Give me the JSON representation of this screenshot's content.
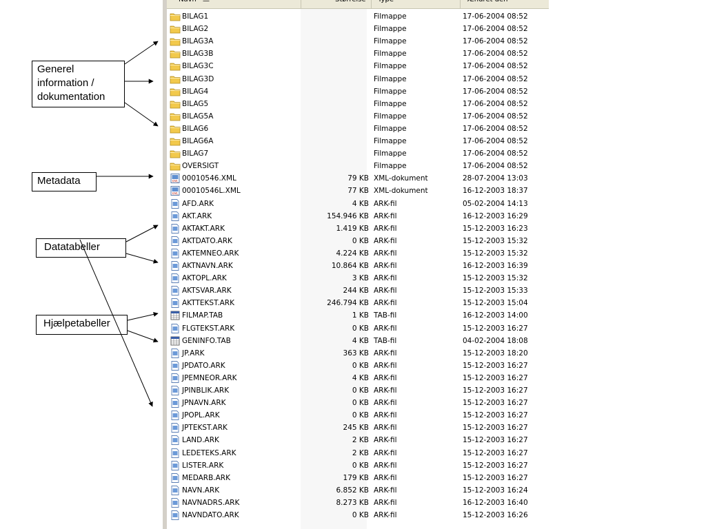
{
  "header": {
    "name": "Navn",
    "size": "Størrelse",
    "type": "Type",
    "modified": "Ændret den"
  },
  "rows": [
    {
      "name": "BILAG1",
      "size": "",
      "type": "Filmappe",
      "date": "17-06-2004 08:52",
      "icon": "folder"
    },
    {
      "name": "BILAG2",
      "size": "",
      "type": "Filmappe",
      "date": "17-06-2004 08:52",
      "icon": "folder"
    },
    {
      "name": "BILAG3A",
      "size": "",
      "type": "Filmappe",
      "date": "17-06-2004 08:52",
      "icon": "folder"
    },
    {
      "name": "BILAG3B",
      "size": "",
      "type": "Filmappe",
      "date": "17-06-2004 08:52",
      "icon": "folder"
    },
    {
      "name": "BILAG3C",
      "size": "",
      "type": "Filmappe",
      "date": "17-06-2004 08:52",
      "icon": "folder"
    },
    {
      "name": "BILAG3D",
      "size": "",
      "type": "Filmappe",
      "date": "17-06-2004 08:52",
      "icon": "folder"
    },
    {
      "name": "BILAG4",
      "size": "",
      "type": "Filmappe",
      "date": "17-06-2004 08:52",
      "icon": "folder"
    },
    {
      "name": "BILAG5",
      "size": "",
      "type": "Filmappe",
      "date": "17-06-2004 08:52",
      "icon": "folder"
    },
    {
      "name": "BILAG5A",
      "size": "",
      "type": "Filmappe",
      "date": "17-06-2004 08:52",
      "icon": "folder"
    },
    {
      "name": "BILAG6",
      "size": "",
      "type": "Filmappe",
      "date": "17-06-2004 08:52",
      "icon": "folder"
    },
    {
      "name": "BILAG6A",
      "size": "",
      "type": "Filmappe",
      "date": "17-06-2004 08:52",
      "icon": "folder"
    },
    {
      "name": "BILAG7",
      "size": "",
      "type": "Filmappe",
      "date": "17-06-2004 08:52",
      "icon": "folder"
    },
    {
      "name": "OVERSIGT",
      "size": "",
      "type": "Filmappe",
      "date": "17-06-2004 08:52",
      "icon": "folder"
    },
    {
      "name": "00010546.XML",
      "size": "79 KB",
      "type": "XML-dokument",
      "date": "28-07-2004 13:03",
      "icon": "xml"
    },
    {
      "name": "00010546L.XML",
      "size": "77 KB",
      "type": "XML-dokument",
      "date": "16-12-2003 18:37",
      "icon": "xml"
    },
    {
      "name": "AFD.ARK",
      "size": "4 KB",
      "type": "ARK-fil",
      "date": "05-02-2004 14:13",
      "icon": "file"
    },
    {
      "name": "AKT.ARK",
      "size": "154.946 KB",
      "type": "ARK-fil",
      "date": "16-12-2003 16:29",
      "icon": "file"
    },
    {
      "name": "AKTAKT.ARK",
      "size": "1.419 KB",
      "type": "ARK-fil",
      "date": "15-12-2003 16:23",
      "icon": "file"
    },
    {
      "name": "AKTDATO.ARK",
      "size": "0 KB",
      "type": "ARK-fil",
      "date": "15-12-2003 15:32",
      "icon": "file"
    },
    {
      "name": "AKTEMNEO.ARK",
      "size": "4.224 KB",
      "type": "ARK-fil",
      "date": "15-12-2003 15:32",
      "icon": "file"
    },
    {
      "name": "AKTNAVN.ARK",
      "size": "10.864 KB",
      "type": "ARK-fil",
      "date": "16-12-2003 16:39",
      "icon": "file"
    },
    {
      "name": "AKTOPL.ARK",
      "size": "3 KB",
      "type": "ARK-fil",
      "date": "15-12-2003 15:32",
      "icon": "file"
    },
    {
      "name": "AKTSVAR.ARK",
      "size": "244 KB",
      "type": "ARK-fil",
      "date": "15-12-2003 15:33",
      "icon": "file"
    },
    {
      "name": "AKTTEKST.ARK",
      "size": "246.794 KB",
      "type": "ARK-fil",
      "date": "15-12-2003 15:04",
      "icon": "file"
    },
    {
      "name": "FILMAP.TAB",
      "size": "1 KB",
      "type": "TAB-fil",
      "date": "16-12-2003 14:00",
      "icon": "tab"
    },
    {
      "name": "FLGTEKST.ARK",
      "size": "0 KB",
      "type": "ARK-fil",
      "date": "15-12-2003 16:27",
      "icon": "file"
    },
    {
      "name": "GENINFO.TAB",
      "size": "4 KB",
      "type": "TAB-fil",
      "date": "04-02-2004 18:08",
      "icon": "tab"
    },
    {
      "name": "JP.ARK",
      "size": "363 KB",
      "type": "ARK-fil",
      "date": "15-12-2003 18:20",
      "icon": "file"
    },
    {
      "name": "JPDATO.ARK",
      "size": "0 KB",
      "type": "ARK-fil",
      "date": "15-12-2003 16:27",
      "icon": "file"
    },
    {
      "name": "JPEMNEOR.ARK",
      "size": "4 KB",
      "type": "ARK-fil",
      "date": "15-12-2003 16:27",
      "icon": "file"
    },
    {
      "name": "JPINBLIK.ARK",
      "size": "0 KB",
      "type": "ARK-fil",
      "date": "15-12-2003 16:27",
      "icon": "file"
    },
    {
      "name": "JPNAVN.ARK",
      "size": "0 KB",
      "type": "ARK-fil",
      "date": "15-12-2003 16:27",
      "icon": "file"
    },
    {
      "name": "JPOPL.ARK",
      "size": "0 KB",
      "type": "ARK-fil",
      "date": "15-12-2003 16:27",
      "icon": "file"
    },
    {
      "name": "JPTEKST.ARK",
      "size": "245 KB",
      "type": "ARK-fil",
      "date": "15-12-2003 16:27",
      "icon": "file"
    },
    {
      "name": "LAND.ARK",
      "size": "2 KB",
      "type": "ARK-fil",
      "date": "15-12-2003 16:27",
      "icon": "file"
    },
    {
      "name": "LEDETEKS.ARK",
      "size": "2 KB",
      "type": "ARK-fil",
      "date": "15-12-2003 16:27",
      "icon": "file"
    },
    {
      "name": "LISTER.ARK",
      "size": "0 KB",
      "type": "ARK-fil",
      "date": "15-12-2003 16:27",
      "icon": "file"
    },
    {
      "name": "MEDARB.ARK",
      "size": "179 KB",
      "type": "ARK-fil",
      "date": "15-12-2003 16:27",
      "icon": "file"
    },
    {
      "name": "NAVN.ARK",
      "size": "6.852 KB",
      "type": "ARK-fil",
      "date": "15-12-2003 16:24",
      "icon": "file"
    },
    {
      "name": "NAVNADRS.ARK",
      "size": "8.273 KB",
      "type": "ARK-fil",
      "date": "16-12-2003 16:40",
      "icon": "file"
    },
    {
      "name": "NAVNDATO.ARK",
      "size": "0 KB",
      "type": "ARK-fil",
      "date": "15-12-2003 16:26",
      "icon": "file"
    }
  ],
  "annotations": {
    "general_line1": "Generel",
    "general_line2": "information /",
    "general_line3": "dokumentation",
    "metadata": "Metadata",
    "datatables": "Datatabeller",
    "helptables": "Hjælpetabeller"
  },
  "colors": {
    "folder": "#f2c94c",
    "panel_border": "#d4d0c8",
    "header_bg": "#ece9d8"
  }
}
